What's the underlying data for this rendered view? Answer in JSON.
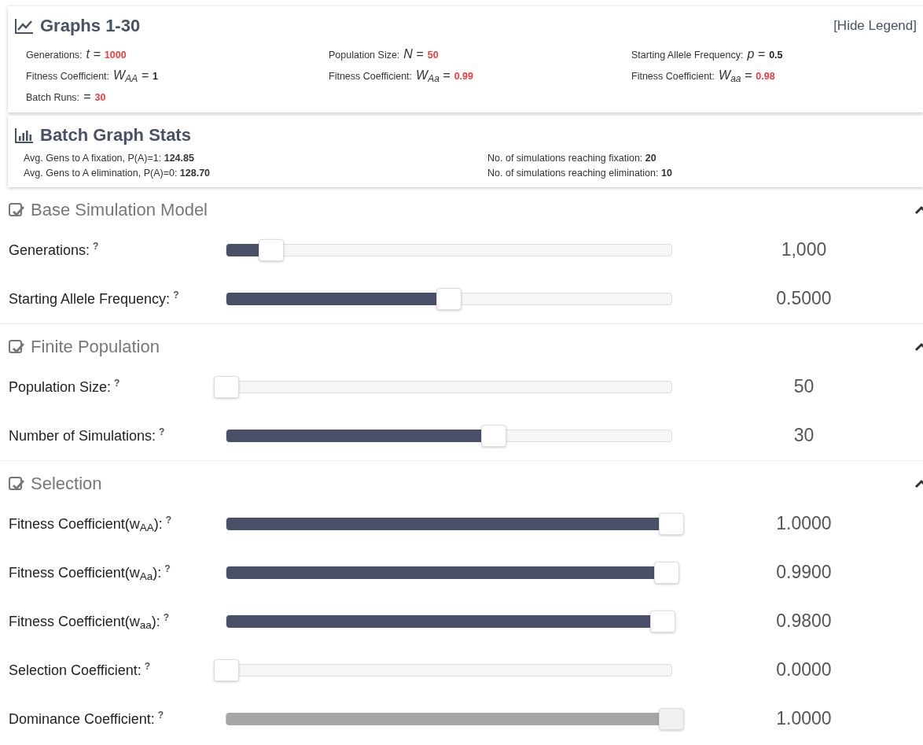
{
  "legend": {
    "title": "Graphs 1-30",
    "toggle": "[Hide Legend]",
    "items": [
      {
        "label": "Generations:",
        "symbol": "t =",
        "value": "1000",
        "highlight": true
      },
      {
        "label": "Population Size:",
        "symbol": "N =",
        "value": "50",
        "highlight": true
      },
      {
        "label": "Starting Allele Frequency:",
        "symbol": "p =",
        "value": "0.5",
        "highlight": false
      },
      {
        "label": "Fitness Coefficient:",
        "symbol": "W$_{AA}$ =",
        "value": "1",
        "highlight": false
      },
      {
        "label": "Fitness Coefficient:",
        "symbol": "W$_{Aa}$ =",
        "value": "0.99",
        "highlight": true
      },
      {
        "label": "Fitness Coefficient:",
        "symbol": "W$_{aa}$ =",
        "value": "0.98",
        "highlight": true
      },
      {
        "label": "Batch Runs:",
        "symbol": "=",
        "value": "30",
        "highlight": true
      }
    ]
  },
  "stats": {
    "title": "Batch Graph Stats",
    "items": [
      {
        "label": "Avg. Gens to A fixation, P(A)=1:",
        "value": "124.85"
      },
      {
        "label": "No. of simulations reaching fixation:",
        "value": "20"
      },
      {
        "label": "Avg. Gens to A elimination, P(A)=0:",
        "value": "128.70"
      },
      {
        "label": "No. of simulations reaching elimination:",
        "value": "10"
      }
    ]
  },
  "sections": [
    {
      "title": "Base Simulation Model",
      "checked": true,
      "expanded": true,
      "rows": [
        {
          "label": "Generations:",
          "help": "?",
          "level": 0.1,
          "reading": "1,000",
          "disabled": false
        },
        {
          "label": "Starting Allele Frequency:",
          "help": "?",
          "level": 0.5,
          "reading": "0.5000",
          "disabled": false
        }
      ]
    },
    {
      "title": "Finite Population",
      "checked": true,
      "expanded": true,
      "rows": [
        {
          "label": "Population Size:",
          "help": "?",
          "level": 0,
          "reading": "50",
          "disabled": false
        },
        {
          "label": "Number of Simulations:",
          "help": "?",
          "level": 0.6,
          "reading": "30",
          "disabled": false
        }
      ]
    },
    {
      "title": "Selection",
      "checked": true,
      "expanded": true,
      "rows": [
        {
          "label": "Fitness Coefficient(w$_{AA}$):",
          "help": "?",
          "level": 1,
          "reading": "1.0000",
          "disabled": false
        },
        {
          "label": "Fitness Coefficient(w$_{Aa}$):",
          "help": "?",
          "level": 0.99,
          "reading": "0.9900",
          "disabled": false
        },
        {
          "label": "Fitness Coefficient(w$_{aa}$):",
          "help": "?",
          "level": 0.98,
          "reading": "0.9800",
          "disabled": false
        },
        {
          "label": "Selection Coefficient:",
          "help": "?",
          "level": 0,
          "reading": "0.0000",
          "disabled": false
        },
        {
          "label": "Dominance Coefficient:",
          "help": "?",
          "level": 1,
          "reading": "1.0000",
          "disabled": true
        }
      ]
    }
  ]
}
